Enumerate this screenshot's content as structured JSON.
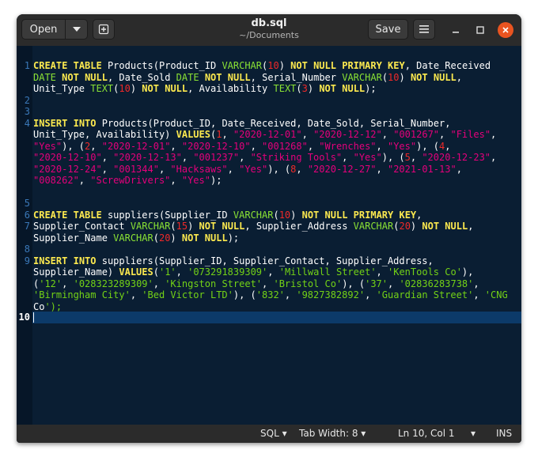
{
  "window": {
    "title": "db.sql",
    "subtitle": "~/Documents"
  },
  "headerbar": {
    "open_label": "Open",
    "save_label": "Save"
  },
  "statusbar": {
    "language": "SQL",
    "tab_width": "Tab Width: 8",
    "position": "Ln 10, Col 1",
    "mode": "INS"
  },
  "editor": {
    "current_line": "10",
    "line_numbers": [
      "1",
      "2",
      "3",
      "4",
      "5",
      "6",
      "7",
      "8",
      "9",
      "10"
    ],
    "code_lines": [
      "CREATE TABLE Products(Product_ID VARCHAR(10) NOT NULL PRIMARY KEY, Date_Received",
      "DATE NOT NULL, Date_Sold DATE NOT NULL, Serial_Number VARCHAR(10) NOT NULL,",
      "Unit_Type TEXT(10) NOT NULL, Availability TEXT(3) NOT NULL);",
      "",
      "",
      "INSERT INTO Products(Product_ID, Date_Received, Date_Sold, Serial_Number,",
      "Unit_Type, Availability) VALUES(1, \"2020-12-01\", \"2020-12-12\", \"001267\", \"Files\",",
      "\"Yes\"), (2, \"2020-12-01\", \"2020-12-10\", \"001268\", \"Wrenches\", \"Yes\"), (4,",
      "\"2020-12-10\", \"2020-12-13\", \"001237\", \"Striking Tools\", \"Yes\"), (5, \"2020-12-23\",",
      "\"2020-12-24\", \"001344\", \"Hacksaws\", \"Yes\"), (8, \"2020-12-27\", \"2021-01-13\",",
      "\"008262\", \"ScrewDrivers\", \"Yes\");",
      "",
      "",
      "CREATE TABLE suppliers(Supplier_ID VARCHAR(10) NOT NULL PRIMARY KEY,",
      "Supplier_Contact VARCHAR(15) NOT NULL, Supplier_Address VARCHAR(20) NOT NULL,",
      "Supplier_Name VARCHAR(20) NOT NULL);",
      "",
      "INSERT INTO suppliers(Supplier_ID, Supplier_Contact, Supplier_Address,",
      "Supplier_Name) VALUES('1', '073291839309', 'Millwall Street', 'KenTools Co'),",
      "('12', '028323289309', 'Kingston Street', 'Bristol Co'), ('37', '02836283738',",
      "'Birmingham City', 'Bed Victor LTD'), ('832', '9827382892', 'Guardian Street', 'CNG",
      "Co');",
      ""
    ]
  },
  "icons": {
    "dropdown": "chevron-down-icon",
    "new_tab": "new-document-icon",
    "menu": "hamburger-menu-icon",
    "minimize": "minimize-icon",
    "maximize": "maximize-icon",
    "close": "close-icon"
  },
  "colors": {
    "editor_bg": "#0a1e33",
    "keyword": "#fce94f",
    "type": "#8ae234",
    "number": "#ef2929",
    "double_string": "#e5007b",
    "single_string": "#73d216",
    "close_button": "#e95420"
  }
}
